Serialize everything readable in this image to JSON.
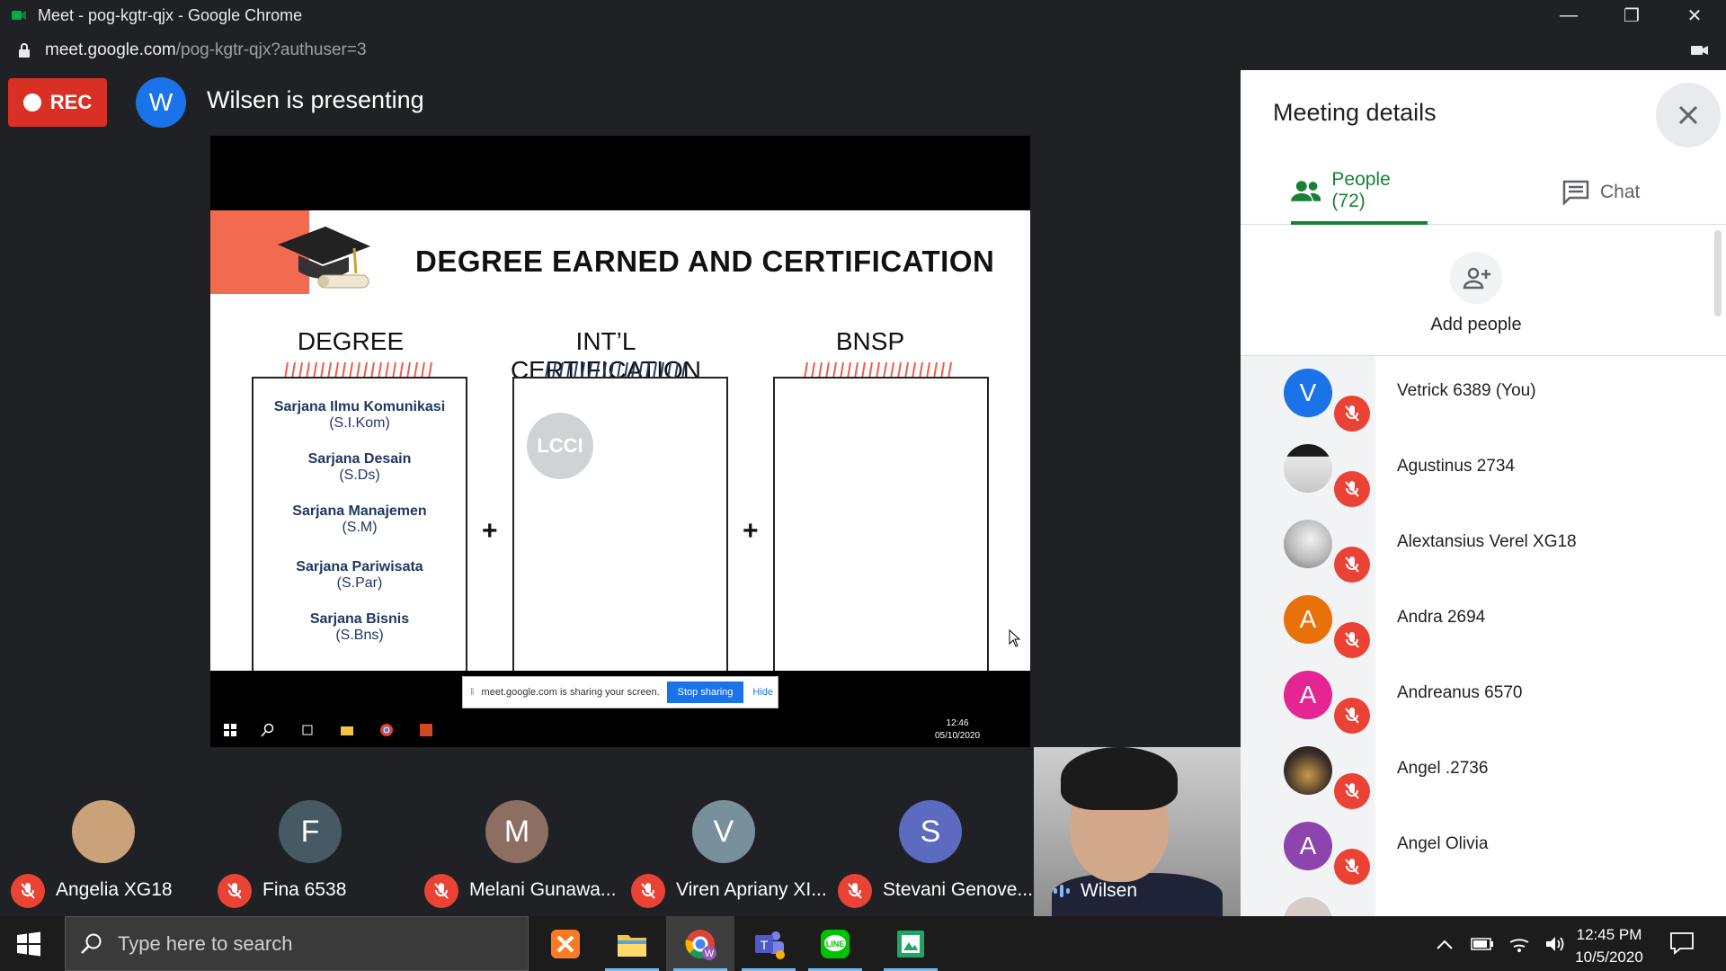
{
  "browser": {
    "window_title": "Meet - pog-kgtr-qjx - Google Chrome",
    "url_host": "meet.google.com",
    "url_rest": "/pog-kgtr-qjx?authuser=3"
  },
  "stage": {
    "rec_label": "REC",
    "presenter_initial": "W",
    "presenting_text": "Wilsen is presenting"
  },
  "slide": {
    "heading": "DEGREE EARNED AND CERTIFICATION",
    "columns": [
      "DEGREE",
      "INT’L CERTIFICATION",
      "BNSP"
    ],
    "plus": "+",
    "degrees": [
      {
        "name": "Sarjana Ilmu Komunikasi",
        "abbr": "(S.I.Kom)"
      },
      {
        "name": "Sarjana Desain",
        "abbr": "(S.Ds)"
      },
      {
        "name": "Sarjana Manajemen",
        "abbr": "(S.M)"
      },
      {
        "name": "Sarjana Pariwisata",
        "abbr": "(S.Par)"
      },
      {
        "name": "Sarjana Bisnis",
        "abbr": "(S.Bns)"
      }
    ],
    "lcci_label": "LCCI"
  },
  "sharebar": {
    "message": "meet.google.com is sharing your screen.",
    "stop_label": "Stop sharing",
    "hide_label": "Hide"
  },
  "mini_taskbar": {
    "time": "12:46",
    "date": "05/10/2020"
  },
  "tiles": [
    {
      "name": "Angelia XG18",
      "initial": "",
      "color": "#c9a27a"
    },
    {
      "name": "Fina 6538",
      "initial": "F",
      "color": "#455a64"
    },
    {
      "name": "Melani Gunawa...",
      "initial": "M",
      "color": "#8d6e63"
    },
    {
      "name": "Viren Apriany XI...",
      "initial": "V",
      "color": "#78909c"
    },
    {
      "name": "Stevani Genove...",
      "initial": "S",
      "color": "#5c6bc0"
    }
  ],
  "self_tile": {
    "name": "Wilsen"
  },
  "panel": {
    "title": "Meeting details",
    "tab_people": "People (72)",
    "tab_chat": "Chat",
    "add_people": "Add people",
    "people": [
      {
        "name": "Vetrick 6389 (You)",
        "initial": "V",
        "color": "#1a73e8"
      },
      {
        "name": "Agustinus 2734",
        "initial": "",
        "color": "#6d7f8a"
      },
      {
        "name": "Alextansius Verel XG18",
        "initial": "",
        "color": "#8a8f96"
      },
      {
        "name": "Andra 2694",
        "initial": "A",
        "color": "#e8710a"
      },
      {
        "name": "Andreanus 6570",
        "initial": "A",
        "color": "#e52592"
      },
      {
        "name": "Angel .2736",
        "initial": "",
        "color": "#3b2f2a"
      },
      {
        "name": "Angel Olivia",
        "initial": "A",
        "color": "#8e44ad"
      }
    ]
  },
  "taskbar": {
    "search_placeholder": "Type here to search",
    "time": "12:45 PM",
    "date": "10/5/2020"
  }
}
